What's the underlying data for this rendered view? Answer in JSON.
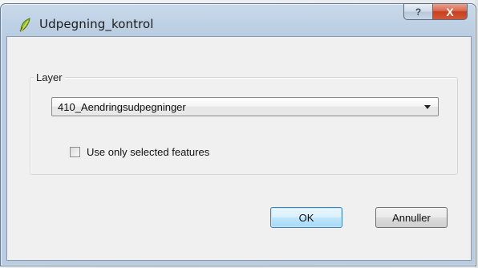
{
  "window": {
    "title": "Udpegning_kontrol",
    "app_icon": "qgis-leaf-icon",
    "help_glyph": "?",
    "close_glyph": "X"
  },
  "layer_group": {
    "label": "Layer",
    "selected_layer": "410_Aendringsudpegninger",
    "use_selected_label": "Use only selected features",
    "use_selected_checked": false
  },
  "buttons": {
    "ok_label": "OK",
    "cancel_label": "Annuller"
  },
  "colors": {
    "titlebar": "#bccfe3",
    "close_button": "#c7401f",
    "dialog_bg": "#f0f0f0",
    "default_button": "#a7d9f5"
  }
}
